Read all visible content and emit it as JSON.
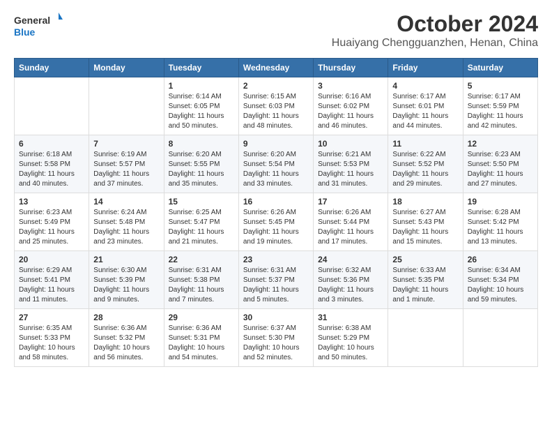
{
  "logo": {
    "line1": "General",
    "line2": "Blue"
  },
  "header": {
    "month": "October 2024",
    "location": "Huaiyang Chengguanzhen, Henan, China"
  },
  "days_of_week": [
    "Sunday",
    "Monday",
    "Tuesday",
    "Wednesday",
    "Thursday",
    "Friday",
    "Saturday"
  ],
  "weeks": [
    [
      {
        "day": "",
        "info": ""
      },
      {
        "day": "",
        "info": ""
      },
      {
        "day": "1",
        "info": "Sunrise: 6:14 AM\nSunset: 6:05 PM\nDaylight: 11 hours and 50 minutes."
      },
      {
        "day": "2",
        "info": "Sunrise: 6:15 AM\nSunset: 6:03 PM\nDaylight: 11 hours and 48 minutes."
      },
      {
        "day": "3",
        "info": "Sunrise: 6:16 AM\nSunset: 6:02 PM\nDaylight: 11 hours and 46 minutes."
      },
      {
        "day": "4",
        "info": "Sunrise: 6:17 AM\nSunset: 6:01 PM\nDaylight: 11 hours and 44 minutes."
      },
      {
        "day": "5",
        "info": "Sunrise: 6:17 AM\nSunset: 5:59 PM\nDaylight: 11 hours and 42 minutes."
      }
    ],
    [
      {
        "day": "6",
        "info": "Sunrise: 6:18 AM\nSunset: 5:58 PM\nDaylight: 11 hours and 40 minutes."
      },
      {
        "day": "7",
        "info": "Sunrise: 6:19 AM\nSunset: 5:57 PM\nDaylight: 11 hours and 37 minutes."
      },
      {
        "day": "8",
        "info": "Sunrise: 6:20 AM\nSunset: 5:55 PM\nDaylight: 11 hours and 35 minutes."
      },
      {
        "day": "9",
        "info": "Sunrise: 6:20 AM\nSunset: 5:54 PM\nDaylight: 11 hours and 33 minutes."
      },
      {
        "day": "10",
        "info": "Sunrise: 6:21 AM\nSunset: 5:53 PM\nDaylight: 11 hours and 31 minutes."
      },
      {
        "day": "11",
        "info": "Sunrise: 6:22 AM\nSunset: 5:52 PM\nDaylight: 11 hours and 29 minutes."
      },
      {
        "day": "12",
        "info": "Sunrise: 6:23 AM\nSunset: 5:50 PM\nDaylight: 11 hours and 27 minutes."
      }
    ],
    [
      {
        "day": "13",
        "info": "Sunrise: 6:23 AM\nSunset: 5:49 PM\nDaylight: 11 hours and 25 minutes."
      },
      {
        "day": "14",
        "info": "Sunrise: 6:24 AM\nSunset: 5:48 PM\nDaylight: 11 hours and 23 minutes."
      },
      {
        "day": "15",
        "info": "Sunrise: 6:25 AM\nSunset: 5:47 PM\nDaylight: 11 hours and 21 minutes."
      },
      {
        "day": "16",
        "info": "Sunrise: 6:26 AM\nSunset: 5:45 PM\nDaylight: 11 hours and 19 minutes."
      },
      {
        "day": "17",
        "info": "Sunrise: 6:26 AM\nSunset: 5:44 PM\nDaylight: 11 hours and 17 minutes."
      },
      {
        "day": "18",
        "info": "Sunrise: 6:27 AM\nSunset: 5:43 PM\nDaylight: 11 hours and 15 minutes."
      },
      {
        "day": "19",
        "info": "Sunrise: 6:28 AM\nSunset: 5:42 PM\nDaylight: 11 hours and 13 minutes."
      }
    ],
    [
      {
        "day": "20",
        "info": "Sunrise: 6:29 AM\nSunset: 5:41 PM\nDaylight: 11 hours and 11 minutes."
      },
      {
        "day": "21",
        "info": "Sunrise: 6:30 AM\nSunset: 5:39 PM\nDaylight: 11 hours and 9 minutes."
      },
      {
        "day": "22",
        "info": "Sunrise: 6:31 AM\nSunset: 5:38 PM\nDaylight: 11 hours and 7 minutes."
      },
      {
        "day": "23",
        "info": "Sunrise: 6:31 AM\nSunset: 5:37 PM\nDaylight: 11 hours and 5 minutes."
      },
      {
        "day": "24",
        "info": "Sunrise: 6:32 AM\nSunset: 5:36 PM\nDaylight: 11 hours and 3 minutes."
      },
      {
        "day": "25",
        "info": "Sunrise: 6:33 AM\nSunset: 5:35 PM\nDaylight: 11 hours and 1 minute."
      },
      {
        "day": "26",
        "info": "Sunrise: 6:34 AM\nSunset: 5:34 PM\nDaylight: 10 hours and 59 minutes."
      }
    ],
    [
      {
        "day": "27",
        "info": "Sunrise: 6:35 AM\nSunset: 5:33 PM\nDaylight: 10 hours and 58 minutes."
      },
      {
        "day": "28",
        "info": "Sunrise: 6:36 AM\nSunset: 5:32 PM\nDaylight: 10 hours and 56 minutes."
      },
      {
        "day": "29",
        "info": "Sunrise: 6:36 AM\nSunset: 5:31 PM\nDaylight: 10 hours and 54 minutes."
      },
      {
        "day": "30",
        "info": "Sunrise: 6:37 AM\nSunset: 5:30 PM\nDaylight: 10 hours and 52 minutes."
      },
      {
        "day": "31",
        "info": "Sunrise: 6:38 AM\nSunset: 5:29 PM\nDaylight: 10 hours and 50 minutes."
      },
      {
        "day": "",
        "info": ""
      },
      {
        "day": "",
        "info": ""
      }
    ]
  ]
}
